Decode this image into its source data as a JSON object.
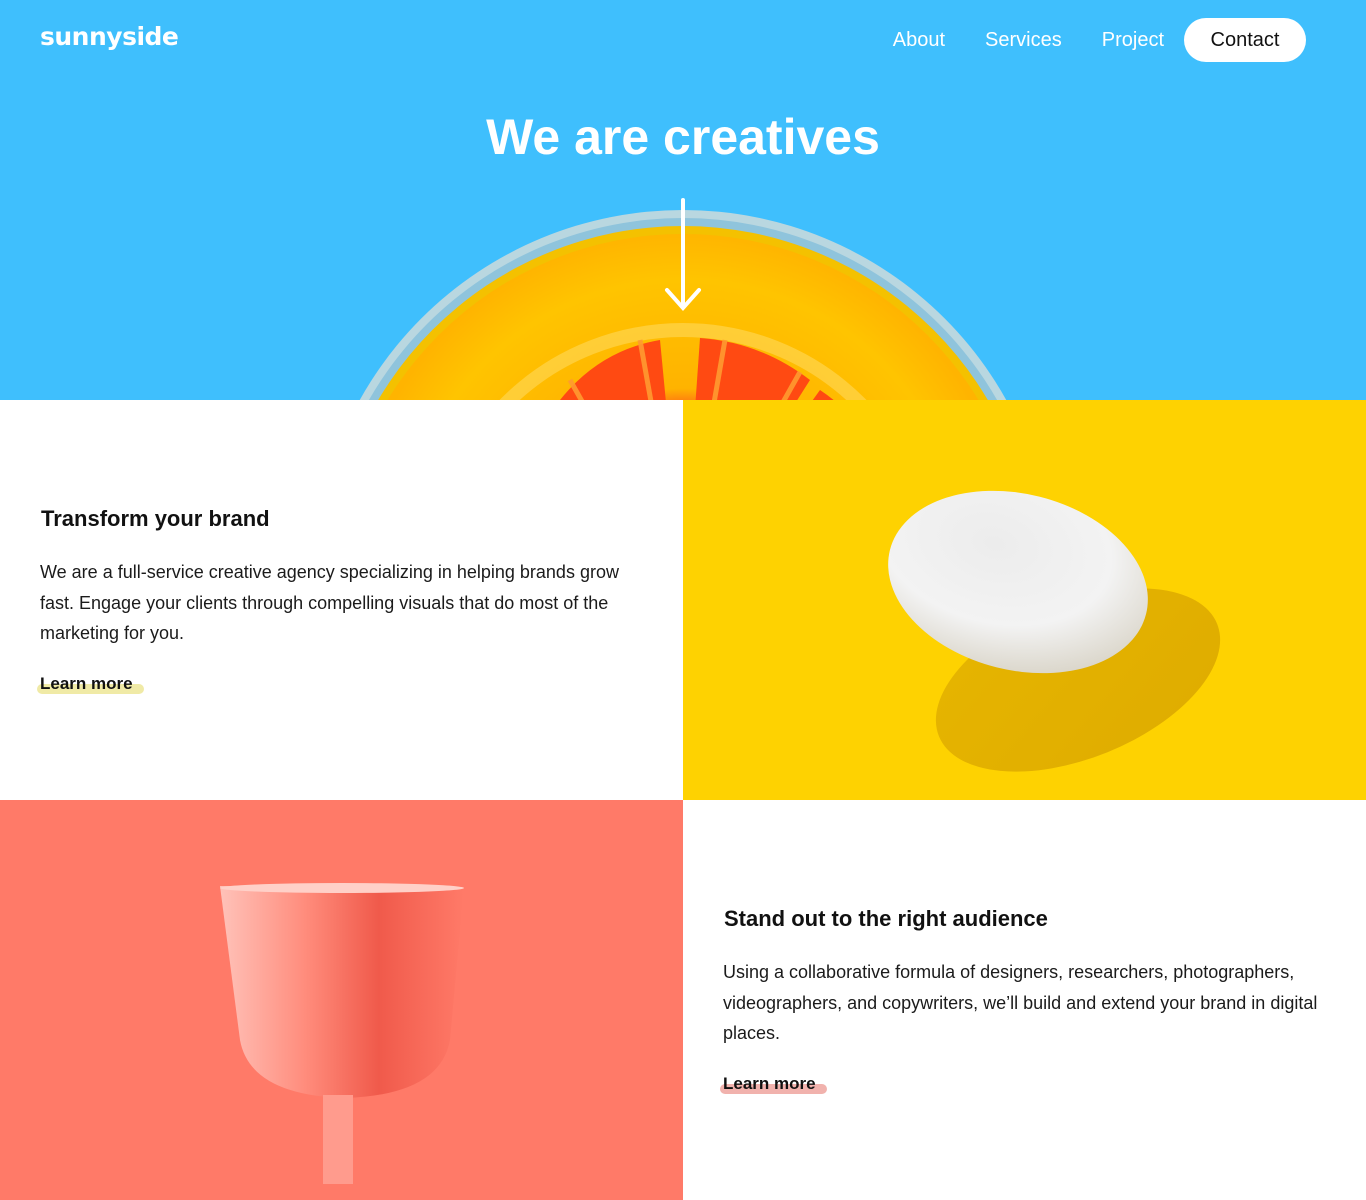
{
  "header": {
    "logo": "sunnyside",
    "nav": [
      {
        "label": "About"
      },
      {
        "label": "Services"
      },
      {
        "label": "Project"
      }
    ],
    "contact_label": "Contact"
  },
  "hero": {
    "title": "We are creatives",
    "icon": "arrow-down-icon",
    "background": "#3fbffd"
  },
  "features": [
    {
      "title": "Transform your brand",
      "body": "We are a full-service creative agency specializing in helping brands grow fast. Engage your clients through compelling visuals that do most of the marketing for you.",
      "link_label": "Learn more",
      "highlight_color": "#f5e9a2"
    },
    {
      "title": "Stand out to the right audience",
      "body": "Using a collaborative formula of designers, researchers, photographers, videographers, and copywriters, we’ll build and extend your brand in digital places.",
      "link_label": "Learn more",
      "highlight_color": "#f3b3ae"
    }
  ],
  "colors": {
    "egg_panel": "#fed201",
    "glass_panel": "#ff7a68"
  }
}
